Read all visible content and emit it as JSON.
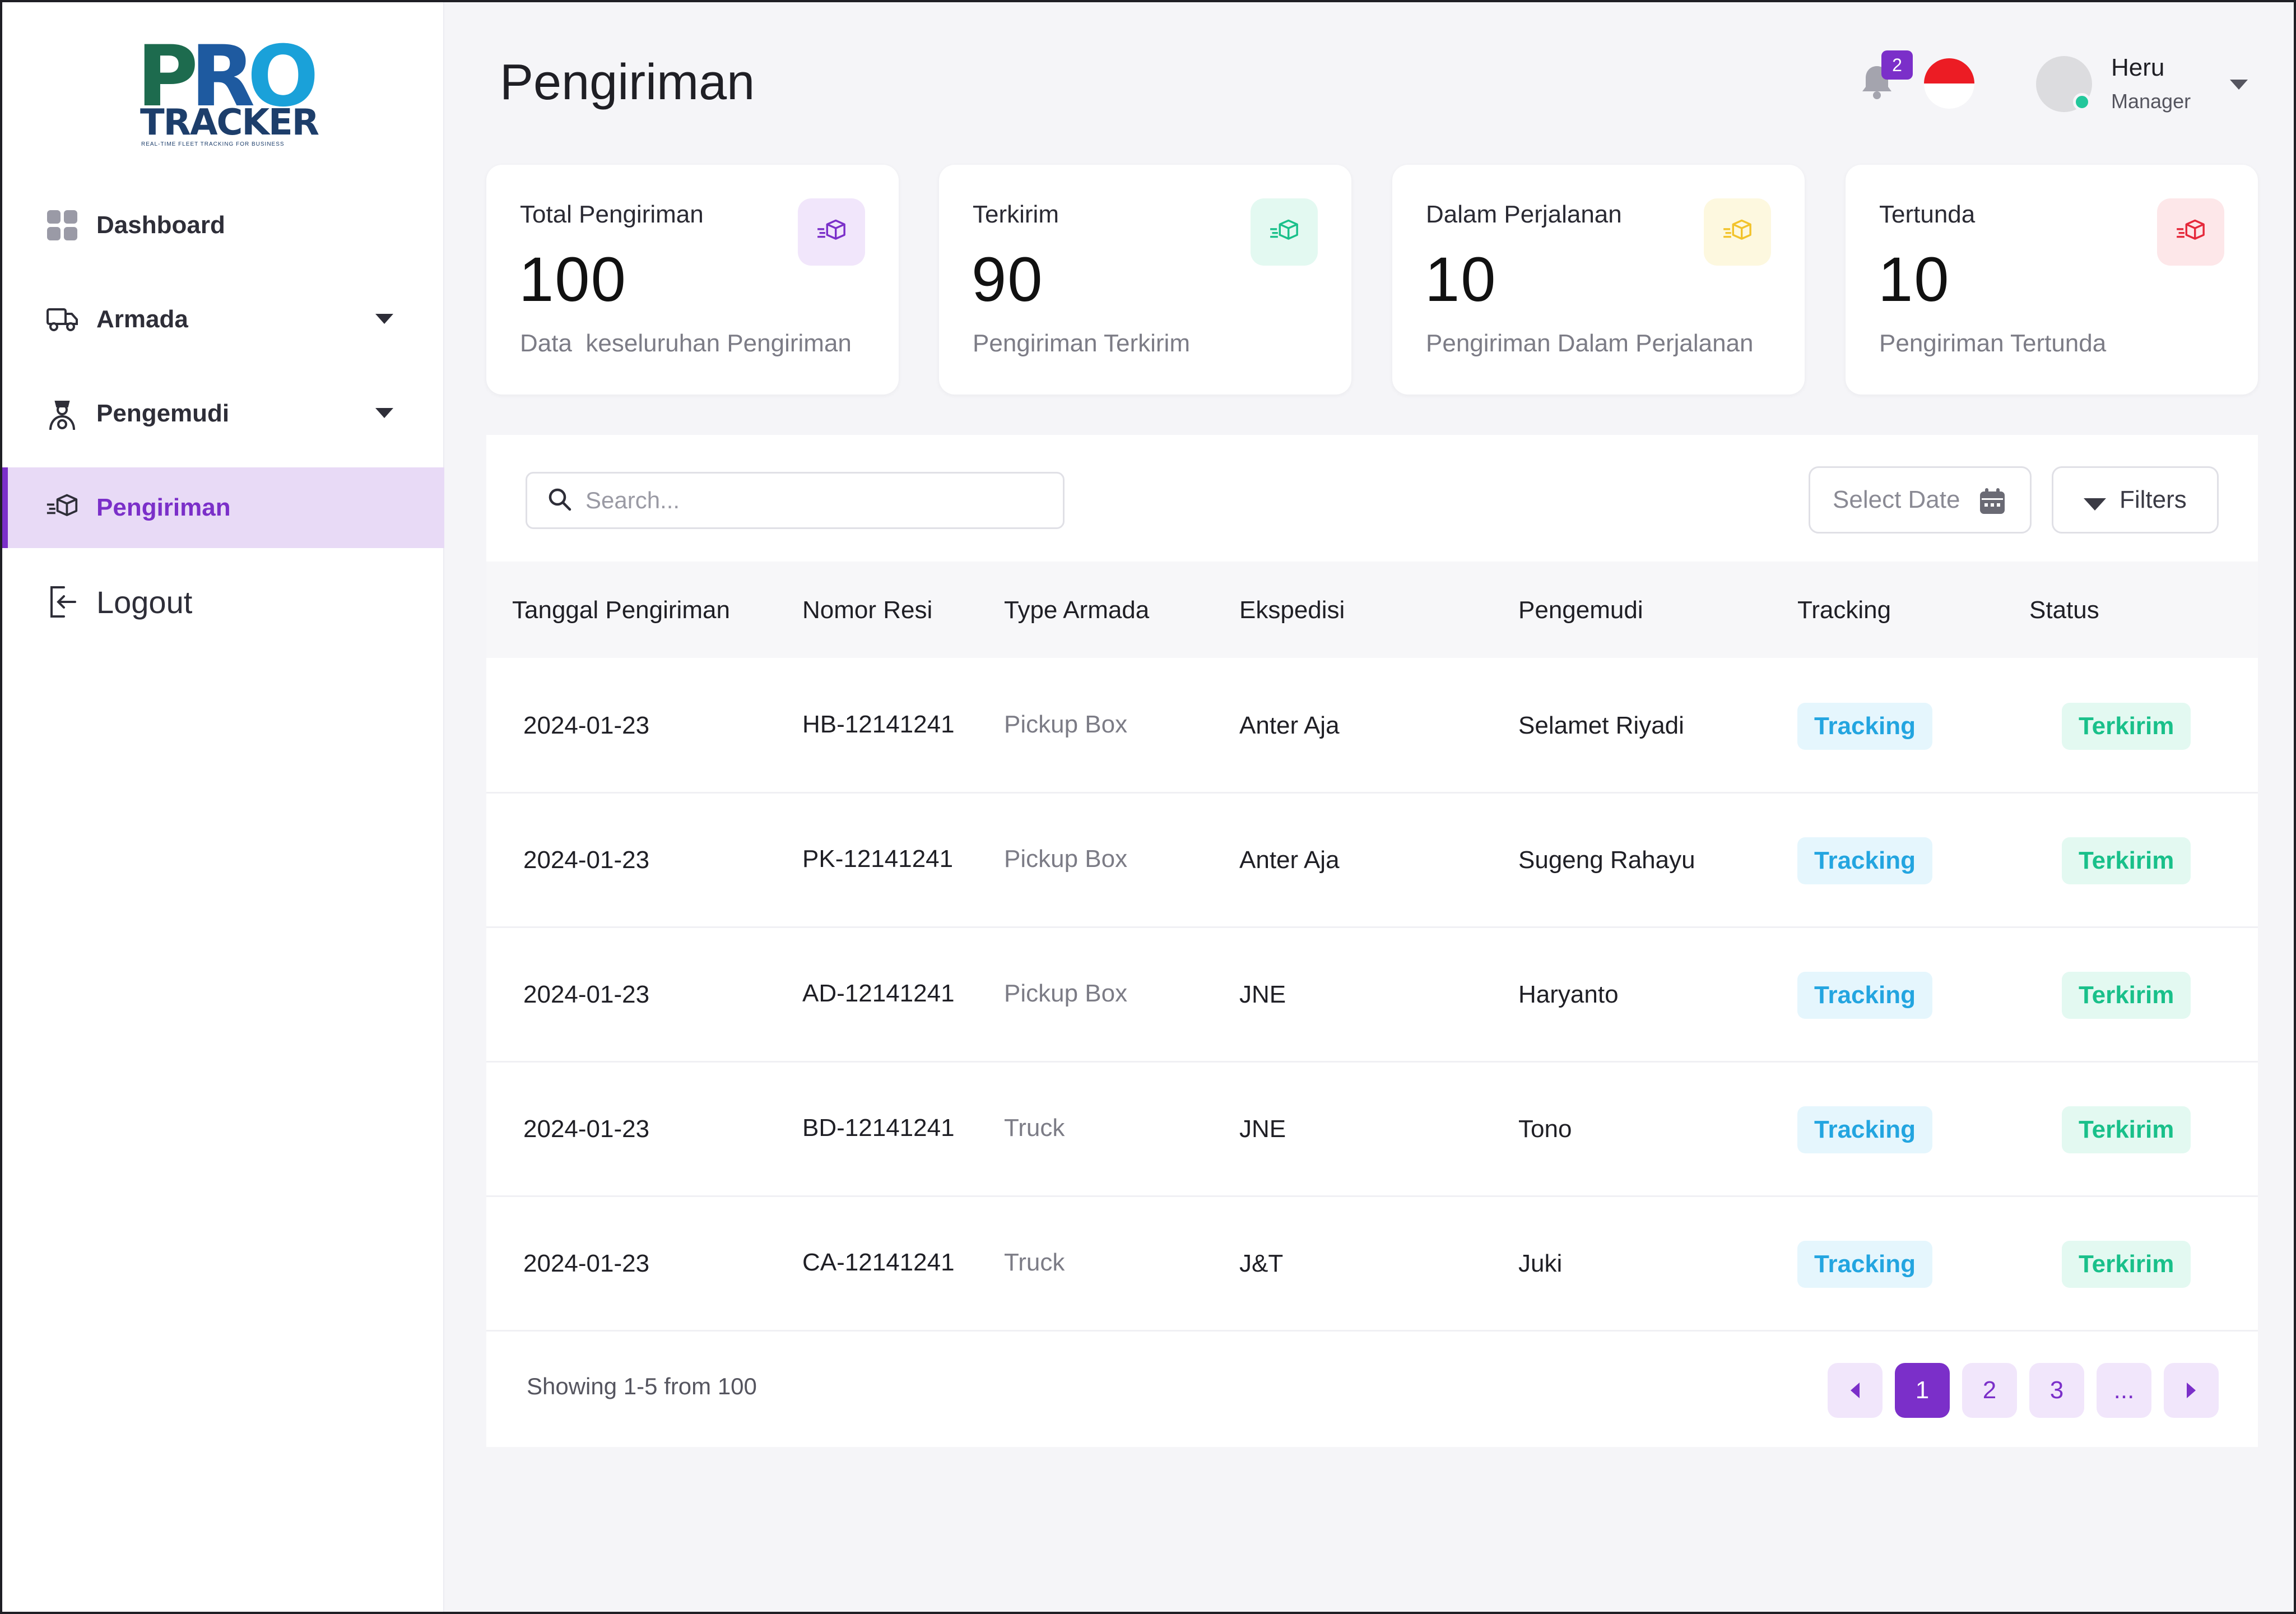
{
  "brand": {
    "logo_text_pro": "PRO",
    "logo_text_tracker": "TRACKER",
    "logo_tagline": "REAL-TIME FLEET TRACKING FOR BUSINESS"
  },
  "sidebar": {
    "items": [
      {
        "label": "Dashboard",
        "icon": "dashboard-icon"
      },
      {
        "label": "Armada",
        "icon": "truck-icon",
        "has_dropdown": true
      },
      {
        "label": "Pengemudi",
        "icon": "driver-icon",
        "has_dropdown": true
      },
      {
        "label": "Pengiriman",
        "icon": "package-icon",
        "active": true
      },
      {
        "label": "Logout",
        "icon": "logout-icon"
      }
    ]
  },
  "header": {
    "title": "Pengiriman",
    "notification_count": "2",
    "language_flag": "indonesia-flag",
    "user": {
      "name": "Heru",
      "role": "Manager",
      "status": "online"
    }
  },
  "cards": [
    {
      "label": "Total Pengiriman",
      "value": "100",
      "desc": "Data  keseluruhan Pengiriman",
      "color": "#7b2fc9",
      "bg": "#f1e6fb"
    },
    {
      "label": "Terkirim",
      "value": "90",
      "desc": "Pengiriman Terkirim",
      "color": "#19c08a",
      "bg": "#e3f9f1"
    },
    {
      "label": "Dalam Perjalanan",
      "value": "10",
      "desc": "Pengiriman Dalam Perjalanan",
      "color": "#f2c32b",
      "bg": "#fdf8df"
    },
    {
      "label": "Tertunda",
      "value": "10",
      "desc": "Pengiriman Tertunda",
      "color": "#e5283a",
      "bg": "#fde7e9"
    }
  ],
  "toolbar": {
    "search_placeholder": "Search...",
    "date_label": "Select Date",
    "filter_label": "Filters"
  },
  "table": {
    "columns": [
      "Tanggal  Pengiriman",
      "Nomor Resi",
      "Type Armada",
      "Ekspedisi",
      "Pengemudi",
      "Tracking",
      "Status"
    ],
    "rows": [
      {
        "date": "2024-01-23",
        "resi": "HB-12141241",
        "armada": "Pickup Box",
        "ekspedisi": "Anter Aja",
        "pengemudi": "Selamet Riyadi",
        "tracking": "Tracking",
        "status": "Terkirim"
      },
      {
        "date": "2024-01-23",
        "resi": "PK-12141241",
        "armada": "Pickup Box",
        "ekspedisi": "Anter Aja",
        "pengemudi": "Sugeng Rahayu",
        "tracking": "Tracking",
        "status": "Terkirim"
      },
      {
        "date": "2024-01-23",
        "resi": "AD-12141241",
        "armada": "Pickup Box",
        "ekspedisi": "JNE",
        "pengemudi": "Haryanto",
        "tracking": "Tracking",
        "status": "Terkirim"
      },
      {
        "date": "2024-01-23",
        "resi": "BD-12141241",
        "armada": "Truck",
        "ekspedisi": "JNE",
        "pengemudi": "Tono",
        "tracking": "Tracking",
        "status": "Terkirim"
      },
      {
        "date": "2024-01-23",
        "resi": "CA-12141241",
        "armada": "Truck",
        "ekspedisi": "J&T",
        "pengemudi": "Juki",
        "tracking": "Tracking",
        "status": "Terkirim"
      }
    ]
  },
  "pagination": {
    "summary": "Showing 1-5 from 100",
    "pages": [
      "1",
      "2",
      "3",
      "..."
    ],
    "current": "1"
  },
  "colors": {
    "accent": "#7b2fc9",
    "tracking": "#23a5e0",
    "status_sent": "#19c08a"
  }
}
